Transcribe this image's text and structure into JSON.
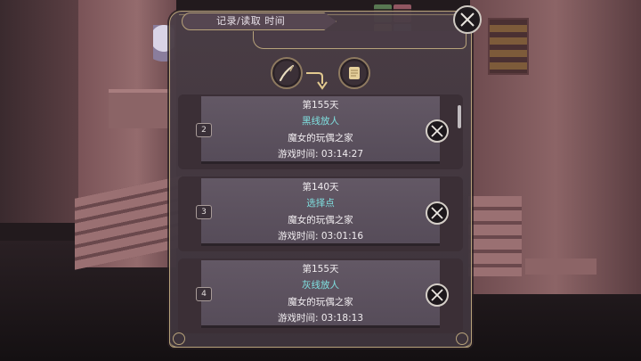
{
  "header": {
    "title": "记录/读取 时间"
  },
  "icons": {
    "close": "close-icon",
    "left_tool": "quill-pen-icon",
    "arrow": "curved-arrow-down-icon",
    "right_tool": "scroll-icon"
  },
  "slots": [
    {
      "number": "2",
      "day": "第155天",
      "route": "黑线放人",
      "location": "魔女的玩偶之家",
      "playtime": "游戏时间:  03:14:27"
    },
    {
      "number": "3",
      "day": "第140天",
      "route": "选择点",
      "location": "魔女的玩偶之家",
      "playtime": "游戏时间:  03:01:16"
    },
    {
      "number": "4",
      "day": "第155天",
      "route": "灰线放人",
      "location": "魔女的玩偶之家",
      "playtime": "游戏时间:  03:18:13"
    }
  ],
  "colors": {
    "route_text": "#7fe0e0",
    "frame_gold": "#b7a27a"
  }
}
